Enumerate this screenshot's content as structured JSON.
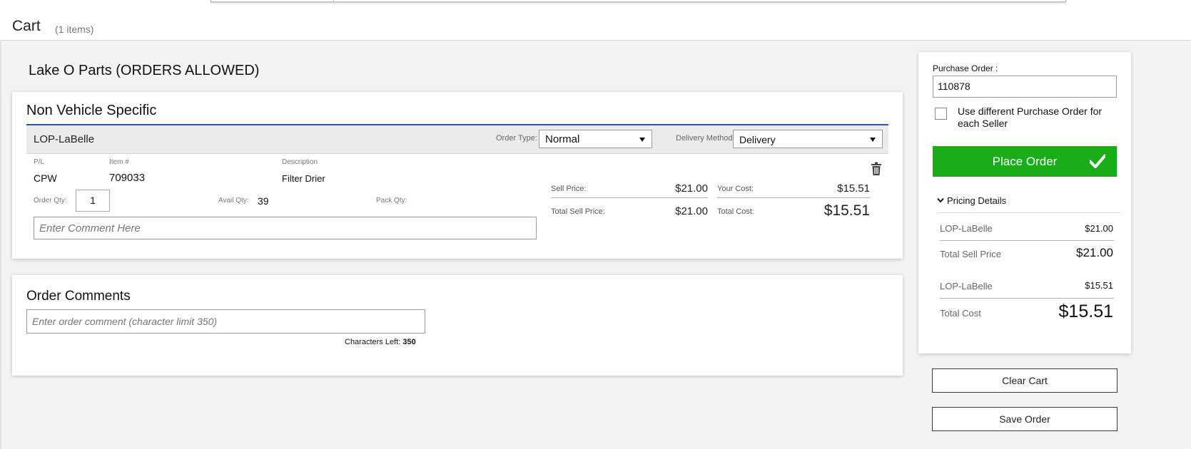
{
  "header": {
    "title": "Cart",
    "item_count": "(1 items)"
  },
  "seller": {
    "title": "Lake O Parts (ORDERS ALLOWED)"
  },
  "group": {
    "title": "Non Vehicle Specific",
    "seller_name": "LOP-LaBelle",
    "order_type_label": "Order Type:",
    "order_type_value": "Normal",
    "delivery_method_label": "Delivery Method:",
    "delivery_method_value": "Delivery"
  },
  "item": {
    "pl_label": "P/L",
    "pl_value": "CPW",
    "item_label": "Item #",
    "item_value": "709033",
    "desc_label": "Description",
    "desc_value": "Filter Drier",
    "order_qty_label": "Order Qty:",
    "order_qty_value": "1",
    "avail_qty_label": "Avail Qty:",
    "avail_qty_value": "39",
    "pack_qty_label": "Pack Qty:",
    "comment_placeholder": "Enter Comment Here",
    "sell_price_label": "Sell Price:",
    "sell_price_value": "$21.00",
    "your_cost_label": "Your Cost:",
    "your_cost_value": "$15.51",
    "total_sell_label": "Total Sell Price:",
    "total_sell_value": "$21.00",
    "total_cost_label": "Total Cost:",
    "total_cost_value": "$15.51"
  },
  "order_comments": {
    "title": "Order Comments",
    "placeholder": "Enter order comment (character limit 350)",
    "chars_left_label": "Characters Left:",
    "chars_left_value": "350"
  },
  "summary": {
    "po_label": "Purchase Order :",
    "po_value": "110878",
    "checkbox_label": "Use different Purchase Order for each Seller",
    "place_order_label": "Place Order",
    "pricing_details_label": "Pricing Details",
    "sell_seller": "LOP-LaBelle",
    "sell_seller_value": "$21.00",
    "total_sell_label": "Total Sell Price",
    "total_sell_value": "$21.00",
    "cost_seller": "LOP-LaBelle",
    "cost_seller_value": "$15.51",
    "total_cost_label": "Total Cost",
    "total_cost_value": "$15.51"
  },
  "actions": {
    "clear_cart": "Clear Cart",
    "save_order": "Save Order"
  },
  "colors": {
    "accent_green": "#1aad1a",
    "accent_blue": "#1a5fb4"
  }
}
